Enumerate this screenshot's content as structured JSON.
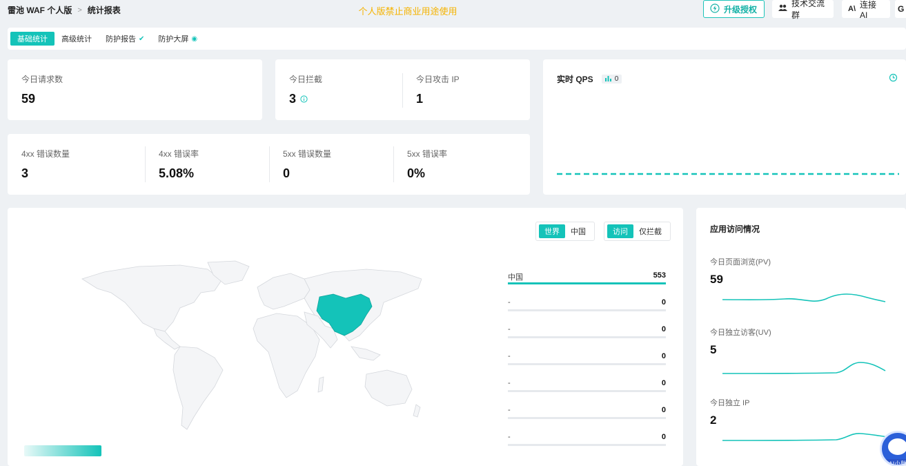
{
  "breadcrumb": {
    "app": "雷池 WAF 个人版",
    "separator": ">",
    "page": "统计报表"
  },
  "notice": "个人版禁止商业用途使用",
  "top_buttons": {
    "upgrade": "升级授权",
    "group": "技术交流群",
    "ai": "连接 AI",
    "ai_icon_text": "A\\",
    "tail_icon_text": "G"
  },
  "tabs": [
    {
      "label": "基础统计",
      "active": true
    },
    {
      "label": "高级统计",
      "active": false
    },
    {
      "label": "防护报告",
      "active": false
    },
    {
      "label": "防护大屏",
      "active": false
    }
  ],
  "stats": {
    "today_requests": {
      "label": "今日请求数",
      "value": "59"
    },
    "today_blocked": {
      "label": "今日拦截",
      "value": "3"
    },
    "today_attack_ip": {
      "label": "今日攻击 IP",
      "value": "1"
    },
    "err_4xx_count": {
      "label": "4xx 错误数量",
      "value": "3"
    },
    "err_4xx_rate": {
      "label": "4xx 错误率",
      "value": "5.08%"
    },
    "err_5xx_count": {
      "label": "5xx 错误数量",
      "value": "0"
    },
    "err_5xx_rate": {
      "label": "5xx 错误率",
      "value": "0%"
    }
  },
  "qps": {
    "title": "实时 QPS",
    "value": "0"
  },
  "map": {
    "scope_toggle": [
      "世界",
      "中国"
    ],
    "scope_selected": "世界",
    "mode_toggle": [
      "访问",
      "仅拦截"
    ],
    "mode_selected": "访问",
    "highlight_color": "#14c3b9"
  },
  "ranking": [
    {
      "name": "中国",
      "value": "553",
      "fraction": 1.0
    },
    {
      "name": "-",
      "value": "0",
      "fraction": 0
    },
    {
      "name": "-",
      "value": "0",
      "fraction": 0
    },
    {
      "name": "-",
      "value": "0",
      "fraction": 0
    },
    {
      "name": "-",
      "value": "0",
      "fraction": 0
    },
    {
      "name": "-",
      "value": "0",
      "fraction": 0
    },
    {
      "name": "-",
      "value": "0",
      "fraction": 0
    }
  ],
  "app_access": {
    "title": "应用访问情况",
    "pv": {
      "label": "今日页面浏览(PV)",
      "value": "59"
    },
    "uv": {
      "label": "今日独立访客(UV)",
      "value": "5"
    },
    "ip": {
      "label": "今日独立 IP",
      "value": "2"
    }
  },
  "ai_assistant_label": "AI小助",
  "colors": {
    "accent": "#14c3b9",
    "notice": "#f5b300"
  }
}
